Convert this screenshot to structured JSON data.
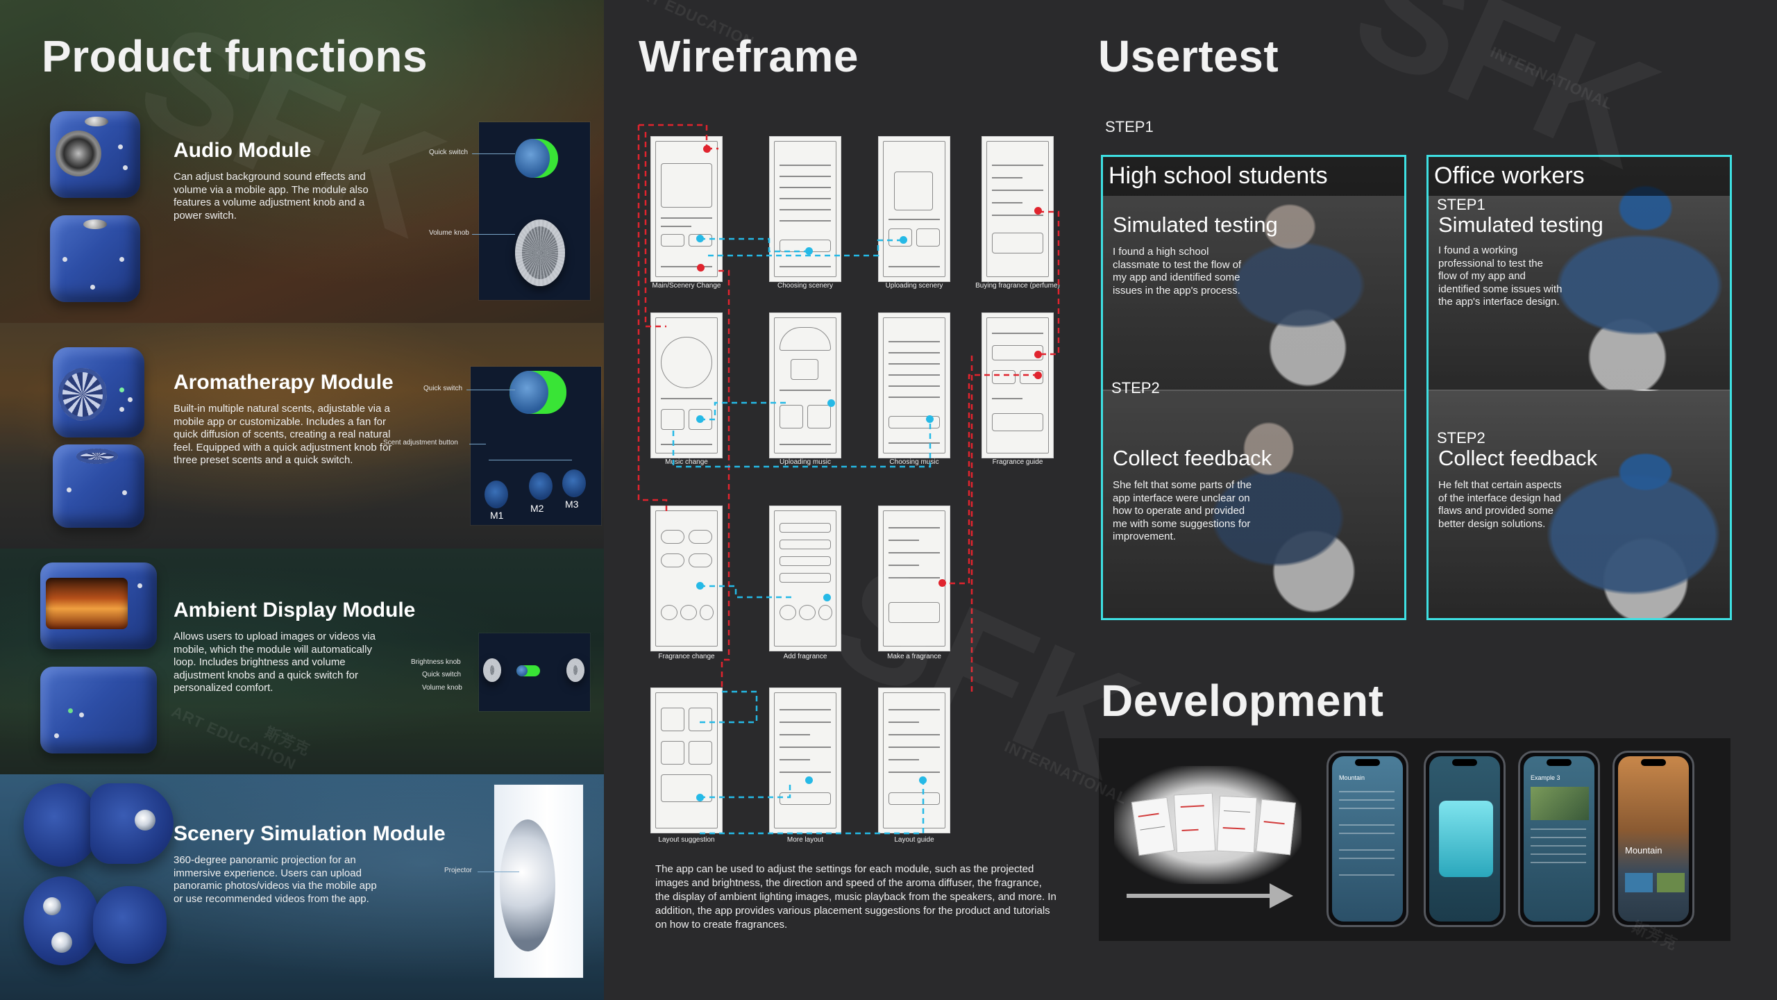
{
  "product_functions": {
    "title": "Product functions",
    "modules": [
      {
        "name": "Audio Module",
        "description": "Can adjust background sound effects and volume via a mobile app. The module also features a volume adjustment knob and a power switch.",
        "controls": [
          "Quick switch",
          "Volume knob"
        ]
      },
      {
        "name": "Aromatherapy Module",
        "description": "Built-in multiple natural scents, adjustable via a mobile app or customizable. Includes a fan for quick diffusion of scents, creating a real natural feel. Equipped with a quick adjustment knob for three preset scents and a quick switch.",
        "controls": [
          "Quick switch",
          "Scent adjustment button"
        ],
        "buttons": [
          "M1",
          "M2",
          "M3"
        ]
      },
      {
        "name": "Ambient Display Module",
        "description": "Allows users to upload images or videos via mobile, which the module will automatically loop. Includes brightness and volume adjustment knobs and a quick switch for personalized comfort.",
        "controls": [
          "Brightness knob",
          "Quick switch",
          "Volume knob"
        ]
      },
      {
        "name": "Scenery Simulation Module",
        "description": "360-degree panoramic projection for an immersive experience. Users can upload panoramic photos/videos via the mobile app or use recommended videos from the app.",
        "controls": [
          "Projector"
        ]
      }
    ]
  },
  "wireframe": {
    "title": "Wireframe",
    "screens": [
      "Main/Scenery Change",
      "Choosing scenery",
      "Uploading scenery",
      "Buying fragrance (perfume)",
      "Music change",
      "Uploading music",
      "Choosing music",
      "Fragrance guide",
      "Fragrance change",
      "Add fragrance",
      "Make a fragrance",
      "Layout suggestion",
      "More layout",
      "Layout guide"
    ],
    "description": "The app can be used to adjust the settings for each module, such as the projected images and brightness, the direction and speed of the aroma diffuser, the fragrance, the display of ambient lighting images, music playback from the speakers, and more. In addition, the app provides various placement suggestions for the product and tutorials on how to create fragrances."
  },
  "usertest": {
    "title": "Usertest",
    "step_label": "STEP1",
    "groups": [
      {
        "name": "High school students",
        "step1_label": "",
        "step1_title": "Simulated testing",
        "step1_text": "I found a high school classmate to test the flow of my app and identified some issues in the app's process.",
        "step2_label": "STEP2",
        "step2_title": "Collect feedback",
        "step2_text": "She felt that some parts of the app interface were unclear on how to operate and provided me with some suggestions for improvement."
      },
      {
        "name": "Office workers",
        "step1_label": "STEP1",
        "step1_title": "Simulated testing",
        "step1_text": "I found a working professional to test the flow of my app and identified some issues with the app's interface design.",
        "step2_label": "STEP2",
        "step2_title": "Collect feedback",
        "step2_text": "He felt that certain aspects of the interface design had flaws and provided some better design solutions."
      }
    ]
  },
  "development": {
    "title": "Development",
    "phones": [
      {
        "heading": "Mountain"
      },
      {
        "heading": ""
      },
      {
        "heading": "Example 3"
      },
      {
        "heading": "Mountain"
      }
    ]
  },
  "watermark": {
    "line1": "INTERNATIONAL",
    "line2": "ART EDUCATION",
    "cn": "斯芳克",
    "big": "SFK"
  },
  "colors": {
    "accent_cyan": "#3ee0e3",
    "toggle_green": "#39e436",
    "wire_blue": "#25b9e6",
    "wire_red": "#e0242e",
    "cube_blue": "#2d4ea6"
  }
}
